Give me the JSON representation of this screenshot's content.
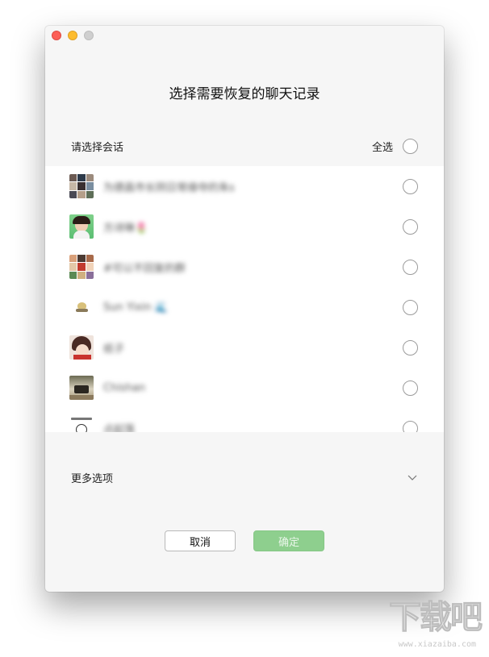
{
  "window": {
    "title": "选择需要恢复的聊天记录"
  },
  "section": {
    "label": "请选择会话",
    "select_all_label": "全选"
  },
  "chats": [
    {
      "name": "为德昌市长阴日常缘夺的朱s",
      "avatar": "group-collage"
    },
    {
      "name": "方诗琳🌷",
      "avatar": "person-green"
    },
    {
      "name": "#可以不回复的群",
      "avatar": "group-collage"
    },
    {
      "name": "Sun Yixin 🌊",
      "avatar": "cartoon"
    },
    {
      "name": "纸子",
      "avatar": "anime"
    },
    {
      "name": "Chishan",
      "avatar": "photo-room"
    },
    {
      "name": "点起落",
      "avatar": "clock-sketch"
    }
  ],
  "more_options": {
    "label": "更多选项"
  },
  "buttons": {
    "cancel": "取消",
    "confirm": "确定"
  },
  "watermark": {
    "text": "下载吧",
    "url": "www.xiazaiba.com"
  },
  "colors": {
    "confirm_bg": "#8ecf8e",
    "close": "#fc5f57",
    "minimize": "#fdbc2e"
  }
}
